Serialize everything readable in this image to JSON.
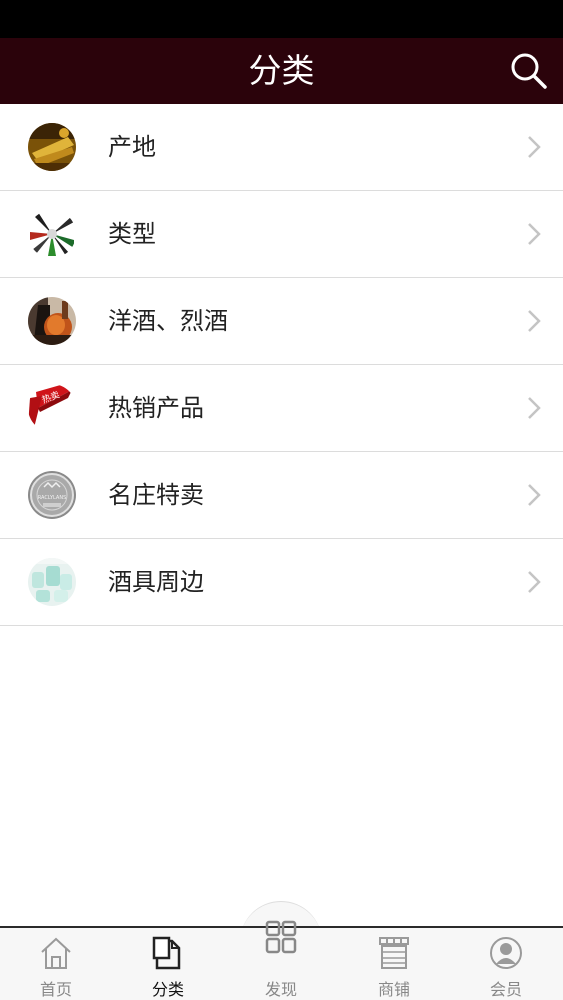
{
  "header": {
    "title": "分类",
    "search_icon": "search-icon"
  },
  "categories": [
    {
      "label": "产地",
      "thumbnail": "gold-wine-thumbnail"
    },
    {
      "label": "类型",
      "thumbnail": "bottle-fan-thumbnail"
    },
    {
      "label": "洋酒、烈酒",
      "thumbnail": "liquor-bottles-thumbnail"
    },
    {
      "label": "热销产品",
      "thumbnail": "hot-sale-ribbon-thumbnail"
    },
    {
      "label": "名庄特卖",
      "thumbnail": "silver-medal-thumbnail"
    },
    {
      "label": "酒具周边",
      "thumbnail": "glassware-thumbnail"
    }
  ],
  "thumb_texts": {
    "hot_sale": "热卖",
    "medal_line": "RACLYLANS"
  },
  "tabs": [
    {
      "label": "首页",
      "icon": "home-icon",
      "active": false
    },
    {
      "label": "分类",
      "icon": "category-icon",
      "active": true
    },
    {
      "label": "发现",
      "icon": "discover-grid-icon",
      "active": false
    },
    {
      "label": "商铺",
      "icon": "store-icon",
      "active": false
    },
    {
      "label": "会员",
      "icon": "member-icon",
      "active": false
    }
  ],
  "colors": {
    "header_bg": "#2b030b",
    "status_bar": "#000000",
    "divider": "#dcdcdc",
    "tab_bar_bg": "#f7f7f7",
    "chevron": "#c4c4c4",
    "tab_icon": "#9a9a9a",
    "active_tab_icon": "#222222"
  }
}
